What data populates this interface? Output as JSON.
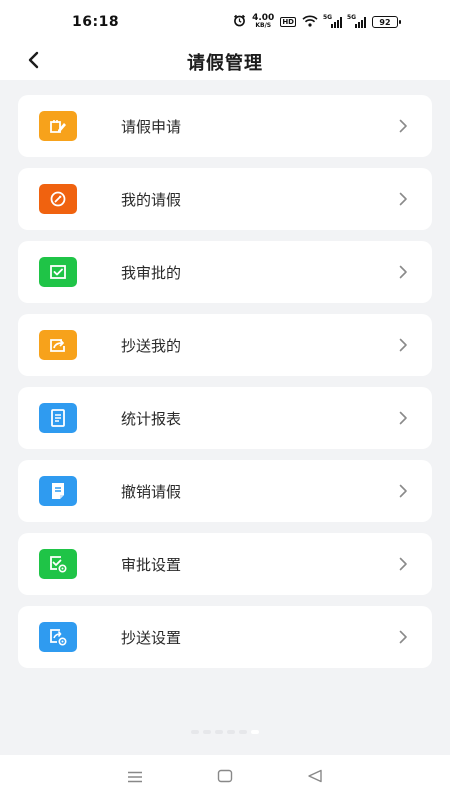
{
  "status_bar": {
    "time": "16:18",
    "net_speed": "4.00",
    "net_unit": "KB/S",
    "hd": "HD",
    "signal_tag_1": "5G",
    "signal_tag_2": "5G",
    "battery": "92"
  },
  "header": {
    "title": "请假管理"
  },
  "menu": {
    "items": [
      {
        "label": "请假申请",
        "icon": "leave-apply-icon",
        "color": "#f7a21b"
      },
      {
        "label": "我的请假",
        "icon": "my-leave-icon",
        "color": "#f0620f"
      },
      {
        "label": "我审批的",
        "icon": "approval-check-icon",
        "color": "#1fc447"
      },
      {
        "label": "抄送我的",
        "icon": "cc-share-icon",
        "color": "#f7a21b"
      },
      {
        "label": "统计报表",
        "icon": "report-icon",
        "color": "#2f9bf0"
      },
      {
        "label": "撤销请假",
        "icon": "cancel-leave-icon",
        "color": "#2f9bf0"
      },
      {
        "label": "审批设置",
        "icon": "approval-settings-icon",
        "color": "#1fc447"
      },
      {
        "label": "抄送设置",
        "icon": "cc-settings-icon",
        "color": "#2f9bf0"
      }
    ]
  }
}
